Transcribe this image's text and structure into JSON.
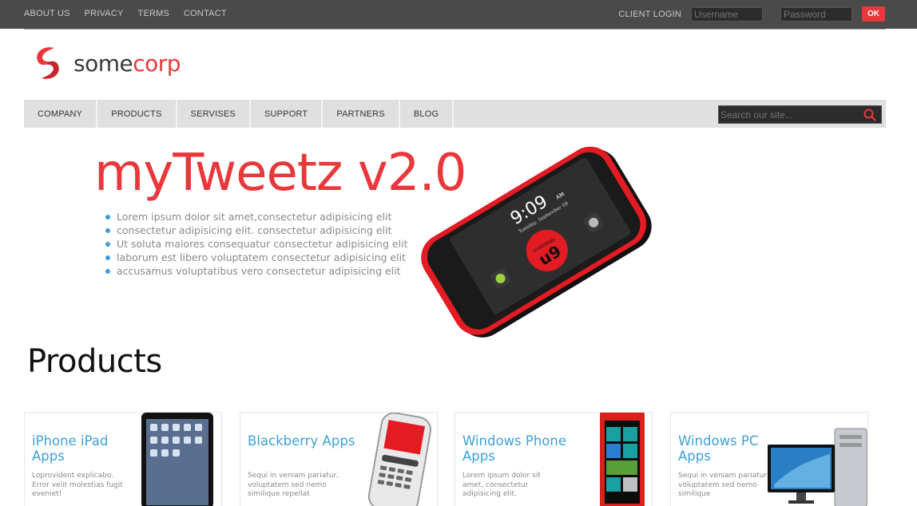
{
  "topbar": {
    "links": [
      "ABOUT US",
      "PRIVACY",
      "TERMS",
      "CONTACT"
    ],
    "client_login_label": "CLIENT LOGIN",
    "username_placeholder": "Username",
    "password_placeholder": "Password",
    "ok_label": "OK"
  },
  "logo": {
    "part1": "some",
    "part2": "corp"
  },
  "nav": {
    "items": [
      "COMPANY",
      "PRODUCTS",
      "SERVISES",
      "SUPPORT",
      "PARTNERS",
      "BLOG"
    ],
    "search_placeholder": "Search our site..."
  },
  "hero": {
    "title": "myTweetz v2.0",
    "bullets": [
      "Lorem ipsum dolor sit amet,consectetur adipisicing elit",
      "consectetur adipisicing elit. consectetur adipisicing elit",
      "Ut soluta maiores consequatur consectetur adipisicing elit",
      "laborum est libero voluptatem consectetur adipisicing elit",
      "accusamus voluptatibus vero consectetur adipisicing elit"
    ],
    "phone_time": "9:09",
    "phone_ampm": "AM",
    "phone_date": "Tuesday, September 09",
    "phone_badge": "u9",
    "phone_brand": "ninetology"
  },
  "products": {
    "title": "Products",
    "cards": [
      {
        "title": "iPhone iPad Apps",
        "desc": "Loprovident explicabo. Error velit molestias fugit eveniet!"
      },
      {
        "title": "Blackberry Apps",
        "desc": "Sequi in veniam pariatur, voluptatem sed nemo similique repellat"
      },
      {
        "title": "Windows Phone Apps",
        "desc": "Lorem ipsum dolor sit amet, consectetur adipisicing elit."
      },
      {
        "title": "Windows PC Apps",
        "desc": "Sequi in veniam pariatur, voluptatem sed nemo similique"
      }
    ]
  },
  "colors": {
    "accent": "#e8383c",
    "link_blue": "#3ea0d8",
    "topbar": "#4a4a4a",
    "nav": "#e0e0e0"
  }
}
